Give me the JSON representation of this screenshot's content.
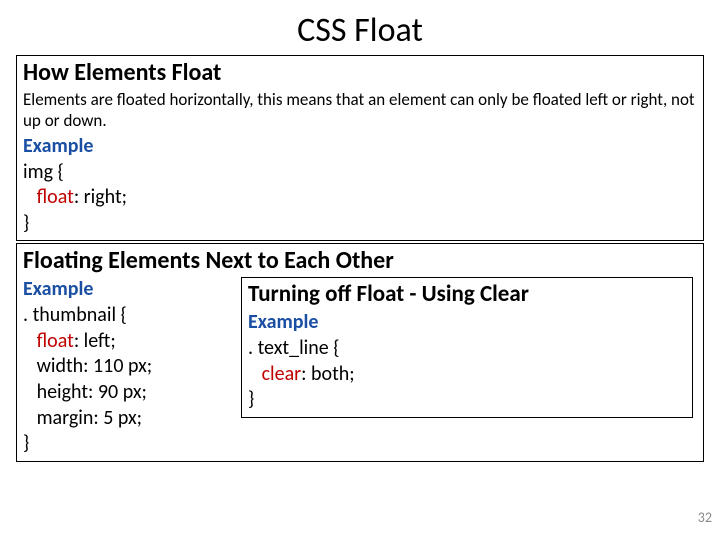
{
  "title": "CSS Float",
  "box1": {
    "heading": "How Elements Float",
    "paragraph": "Elements are floated horizontally, this means that an element can only be floated left or right, not up or down.",
    "example_label": "Example",
    "code_pre": "img {\n   ",
    "code_kw": "float",
    "code_post": ": right;\n}"
  },
  "box3": {
    "heading": "Floating Elements Next to Each Other",
    "example_label": "Example",
    "code_pre": ". thumbnail {\n   ",
    "code_kw": "float",
    "code_post": ": left;\n   width: 110 px;\n   height: 90 px;\n   margin: 5 px;\n}"
  },
  "box4": {
    "heading": "Turning off Float - Using Clear",
    "example_label": "Example",
    "code_pre": ". text_line {\n   ",
    "code_kw": "clear",
    "code_post": ": both;\n}"
  },
  "page_number": "32"
}
